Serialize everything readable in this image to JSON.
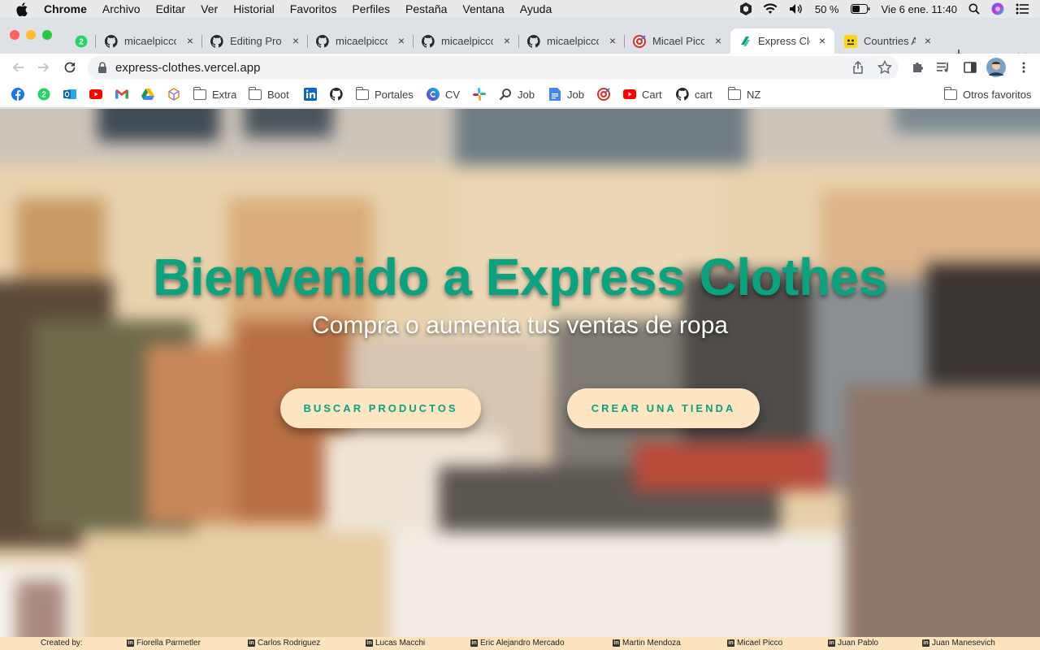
{
  "menubar": {
    "app_name": "Chrome",
    "items": [
      "Archivo",
      "Editar",
      "Ver",
      "Historial",
      "Favoritos",
      "Perfiles",
      "Pestaña",
      "Ventana",
      "Ayuda"
    ],
    "battery": "50 %",
    "datetime": "Vie 6 ene.  11:40"
  },
  "tabs": [
    {
      "label": "",
      "icon": "whatsapp-icon",
      "badge": "2"
    },
    {
      "label": "micaelpicco",
      "icon": "github-icon"
    },
    {
      "label": "Editing Proy",
      "icon": "github-icon"
    },
    {
      "label": "micaelpicco",
      "icon": "github-icon"
    },
    {
      "label": "micaelpicco",
      "icon": "github-icon"
    },
    {
      "label": "micaelpicco",
      "icon": "github-icon"
    },
    {
      "label": "Micael Picco",
      "icon": "target-icon"
    },
    {
      "label": "Express Clo",
      "icon": "vercel-site-icon",
      "active": true
    },
    {
      "label": "Countries A",
      "icon": "yellow-app-icon"
    }
  ],
  "toolbar": {
    "url": "express-clothes.vercel.app"
  },
  "bookmarks": [
    {
      "label": "",
      "icon": "facebook-icon"
    },
    {
      "label": "",
      "icon": "whatsapp-icon"
    },
    {
      "label": "",
      "icon": "outlook-icon"
    },
    {
      "label": "",
      "icon": "youtube-icon"
    },
    {
      "label": "",
      "icon": "gmail-icon"
    },
    {
      "label": "",
      "icon": "drive-icon"
    },
    {
      "label": "",
      "icon": "cube-icon"
    },
    {
      "label": "Extra",
      "icon": "folder-icon"
    },
    {
      "label": "Boot",
      "icon": "folder-icon"
    },
    {
      "label": "",
      "icon": "linkedin-icon"
    },
    {
      "label": "",
      "icon": "github-icon"
    },
    {
      "label": "Portales",
      "icon": "folder-icon"
    },
    {
      "label": "CV",
      "icon": "canva-icon"
    },
    {
      "label": "",
      "icon": "slack-icon"
    },
    {
      "label": "Job",
      "icon": "search-icon"
    },
    {
      "label": "Job",
      "icon": "docs-icon"
    },
    {
      "label": "",
      "icon": "target-icon"
    },
    {
      "label": "Cart",
      "icon": "youtube-icon"
    },
    {
      "label": "cart",
      "icon": "github-icon"
    },
    {
      "label": "NZ",
      "icon": "folder-icon"
    },
    {
      "label": "Otros favoritos",
      "icon": "folder-icon"
    }
  ],
  "hero": {
    "title": "Bienvenido a Express Clothes",
    "subtitle": "Compra o aumenta tus ventas de ropa",
    "button_search": "BUSCAR PRODUCTOS",
    "button_create": "CREAR UNA TIENDA"
  },
  "footer": {
    "created_by": "Created by:",
    "authors": [
      "Fiorella Parmetler",
      "Carlos Rodriguez",
      "Lucas Macchi",
      "Eric Alejandro Mercado",
      "Martin Mendoza",
      "Micael Picco",
      "Juan Pablo",
      "Juan Manesevich"
    ]
  },
  "colors": {
    "accent": "#0aa27f",
    "button_bg": "#fde6c1",
    "footer_bg": "#fbe3bd"
  }
}
